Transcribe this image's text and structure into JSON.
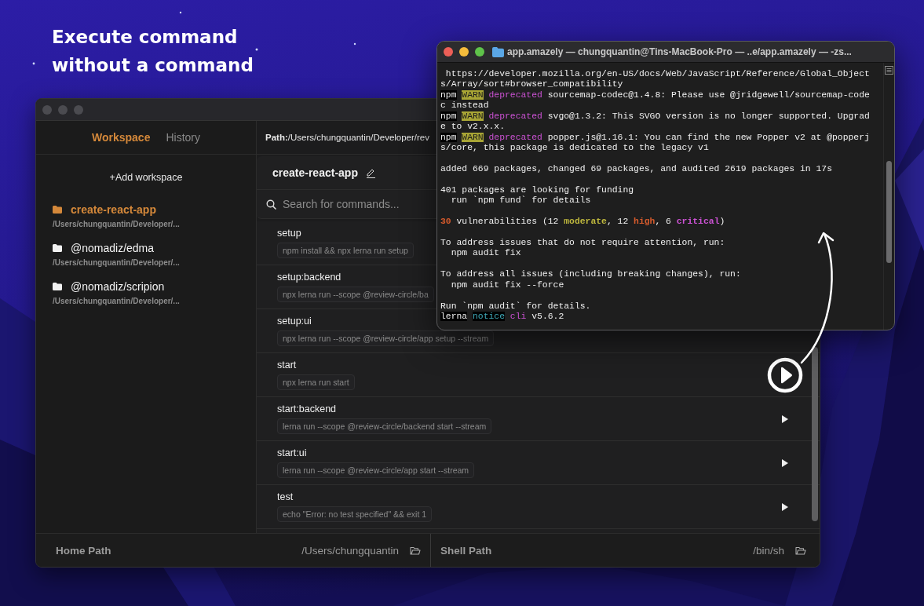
{
  "headline": [
    "Execute command",
    "without a command"
  ],
  "app_window": {
    "sidebar": {
      "tabs": [
        {
          "label": "Workspace",
          "selected": true
        },
        {
          "label": "History",
          "selected": false
        }
      ],
      "add_button": "+Add workspace",
      "items": [
        {
          "name": "create-react-app",
          "path": "/Users/chungquantin/Developer/...",
          "selected": true
        },
        {
          "name": "@nomadiz/edma",
          "path": "/Users/chungquantin/Developer/...",
          "selected": false
        },
        {
          "name": "@nomadiz/scripion",
          "path": "/Users/chungquantin/Developer/...",
          "selected": false
        }
      ]
    },
    "path_bar": "**Path:**/Users/chungquantin/Developer/rev",
    "workspace_title": "create-react-app",
    "search": {
      "placeholder": "Search for commands..."
    },
    "commands": [
      {
        "name": "setup",
        "command": "npm install && npx lerna run setup",
        "kind": "covered"
      },
      {
        "name": "setup:backend",
        "command": "npx lerna run --scope @review-circle/ba",
        "kind": "covered"
      },
      {
        "name": "setup:ui",
        "command": "npx lerna run --scope @review-circle/app setup --stream",
        "kind": "covered"
      },
      {
        "name": "start",
        "command": "npx lerna run start",
        "kind": "highlighted"
      },
      {
        "name": "start:backend",
        "command": "lerna run --scope @review-circle/backend start --stream",
        "kind": "runnable"
      },
      {
        "name": "start:ui",
        "command": "lerna run --scope @review-circle/app start --stream",
        "kind": "runnable"
      },
      {
        "name": "test",
        "command": "echo \"Error: no test specified\" && exit 1",
        "kind": "runnable"
      }
    ],
    "footer": {
      "home_label": "Home Path",
      "home_value": "/Users/chungquantin",
      "shell_label": "Shell Path",
      "shell_value": "/bin/sh"
    }
  },
  "terminal": {
    "title": "app.amazely — chungquantin@Tins-MacBook-Pro — ..e/app.amazely — -zs...",
    "lines": [
      {
        "segments": [
          {
            "text": " https://developer.mozilla.org/en-US/docs/Web/JavaScript/Reference/Global_Object",
            "kind": "plain"
          }
        ]
      },
      {
        "segments": [
          {
            "text": "s/Array/sort#browser_compatibility",
            "kind": "plain"
          }
        ]
      },
      {
        "segments": [
          {
            "text": "npm",
            "kind": "label"
          },
          {
            "text": "WARN",
            "kind": "warn"
          },
          {
            "text": "deprecated",
            "kind": "deprecated"
          },
          {
            "text": " sourcemap-codec@1.4.8: Please use @jridgewell/sourcemap-code",
            "kind": "plain"
          }
        ]
      },
      {
        "segments": [
          {
            "text": "c instead",
            "kind": "plain"
          }
        ]
      },
      {
        "segments": [
          {
            "text": "npm",
            "kind": "label"
          },
          {
            "text": "WARN",
            "kind": "warn"
          },
          {
            "text": "deprecated",
            "kind": "deprecated"
          },
          {
            "text": " svgo@1.3.2: This SVGO version is no longer supported. Upgrad",
            "kind": "plain"
          }
        ]
      },
      {
        "segments": [
          {
            "text": "e to v2.x.x.",
            "kind": "plain"
          }
        ]
      },
      {
        "segments": [
          {
            "text": "npm",
            "kind": "label"
          },
          {
            "text": "WARN",
            "kind": "warn"
          },
          {
            "text": "deprecated",
            "kind": "deprecated"
          },
          {
            "text": " popper.js@1.16.1: You can find the new Popper v2 at @popperj",
            "kind": "plain"
          }
        ]
      },
      {
        "segments": [
          {
            "text": "s/core, this package is dedicated to the legacy v1",
            "kind": "plain"
          }
        ]
      },
      {
        "kind": "blank"
      },
      {
        "segments": [
          {
            "text": "added 669 packages, changed 69 packages, and audited 2619 packages in 17s",
            "kind": "plain"
          }
        ]
      },
      {
        "kind": "blank"
      },
      {
        "segments": [
          {
            "text": "401 packages are looking for funding",
            "kind": "plain"
          }
        ]
      },
      {
        "segments": [
          {
            "text": "  run `npm fund` for details",
            "kind": "plain"
          }
        ]
      },
      {
        "kind": "blank"
      },
      {
        "segments": [
          {
            "text": "30",
            "kind": "total"
          },
          {
            "text": " vulnerabilities (12 ",
            "kind": "plain"
          },
          {
            "text": "moderate",
            "kind": "moderate"
          },
          {
            "text": ", 12 ",
            "kind": "plain"
          },
          {
            "text": "high",
            "kind": "high"
          },
          {
            "text": ", 6 ",
            "kind": "plain"
          },
          {
            "text": "critical",
            "kind": "critical"
          },
          {
            "text": ")",
            "kind": "plain"
          }
        ]
      },
      {
        "kind": "blank"
      },
      {
        "segments": [
          {
            "text": "To address issues that do not require attention, run:",
            "kind": "plain"
          }
        ]
      },
      {
        "segments": [
          {
            "text": "  npm audit fix",
            "kind": "plain"
          }
        ]
      },
      {
        "kind": "blank"
      },
      {
        "segments": [
          {
            "text": "To address all issues (including breaking changes), run:",
            "kind": "plain"
          }
        ]
      },
      {
        "segments": [
          {
            "text": "  npm audit fix --force",
            "kind": "plain"
          }
        ]
      },
      {
        "kind": "blank"
      },
      {
        "segments": [
          {
            "text": "Run `npm audit` for details.",
            "kind": "plain"
          }
        ]
      },
      {
        "segments": [
          {
            "text": "lerna",
            "kind": "label"
          },
          {
            "text": "notice",
            "kind": "notice"
          },
          {
            "text": "cli",
            "kind": "deprecated"
          },
          {
            "text": " v5.6.2",
            "kind": "plain"
          }
        ]
      }
    ]
  }
}
